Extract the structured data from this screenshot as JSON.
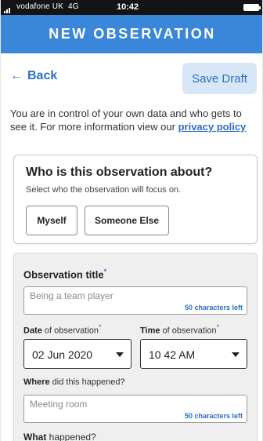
{
  "status_bar": {
    "carrier": "vodafone UK",
    "network": "4G",
    "time": "10:42"
  },
  "header": {
    "title": "NEW OBSERVATION"
  },
  "nav": {
    "back_label": "Back",
    "save_draft_label": "Save Draft"
  },
  "intro": {
    "text": "You are in control of your own data and who gets to see it. For more information view our ",
    "link": "privacy policy"
  },
  "about_card": {
    "heading": "Who is this observation about?",
    "subtext": "Select who the observation will focus on.",
    "options": [
      "Myself",
      "Someone Else"
    ]
  },
  "form": {
    "required_marker": "*",
    "title_label": "Observation title",
    "title_placeholder": "Being a team player",
    "title_counter": "50 characters left",
    "date_label_bold": "Date",
    "date_label_rest": " of observation",
    "date_value": "02 Jun 2020",
    "time_label_bold": "Time",
    "time_label_rest": " of observation",
    "time_value": "10 42 AM",
    "where_label_bold": "Where",
    "where_label_rest": " did this happened?",
    "where_placeholder": "Meeting room",
    "where_counter": "50 characters left",
    "what_label_bold": "What",
    "what_label_rest": " happened?"
  },
  "colors": {
    "header_bg": "#3a86d9",
    "accent": "#2d6fc4",
    "save_draft_bg": "#d8e7f7",
    "panel_bg": "#efefef"
  }
}
